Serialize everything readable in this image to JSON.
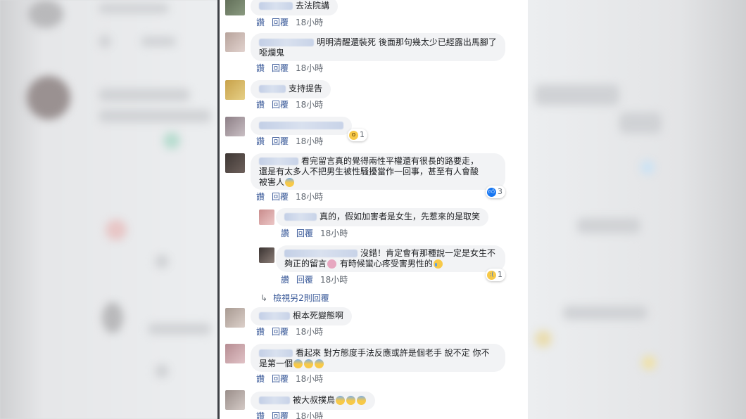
{
  "actions": {
    "like": "讚",
    "reply": "回覆",
    "time": "18小時"
  },
  "comments": [
    {
      "text": "去法院講"
    },
    {
      "text": "明明清醒還裝死 後面那句幾太少已經露出馬腳了 噁爛鬼"
    },
    {
      "text": "支持提告"
    },
    {
      "text": "",
      "reaction_count": "1"
    },
    {
      "text_line1": "看完留言真的覺得兩性平權還有很長的路要走，",
      "text_line2": "還是有太多人不把男生被性騷擾當作一回事，甚至有人會酸",
      "text_line3": "被害人",
      "reaction_count": "3"
    },
    {
      "text": "真的，假如加害者是女生，先惹來的是取笑"
    },
    {
      "text_line1": "沒錯！肯定會有那種說一定是女生不",
      "text_line2": "夠正的留言",
      "text_line2b": "有時候蠻心疼受害男性的",
      "reaction_count": "1"
    },
    {
      "text": "根本死變態啊"
    },
    {
      "text_line1": "看起來 對方態度手法反應或許是個老手 說不定 你不",
      "text_line2": "是第一個"
    },
    {
      "text": "被大叔撲鳥"
    }
  ],
  "view_more": "檢視另2則回覆",
  "colors": {
    "link": "#385898",
    "bubble": "#f2f3f5",
    "text": "#1c1e21",
    "meta": "#606770",
    "like_blue": "#1877f2"
  },
  "icons": {
    "reply_arrow": "reply-arrow-icon",
    "like_reaction": "like-reaction-icon",
    "wow_reaction": "wow-reaction-icon",
    "sad_reaction": "sad-reaction-icon"
  }
}
